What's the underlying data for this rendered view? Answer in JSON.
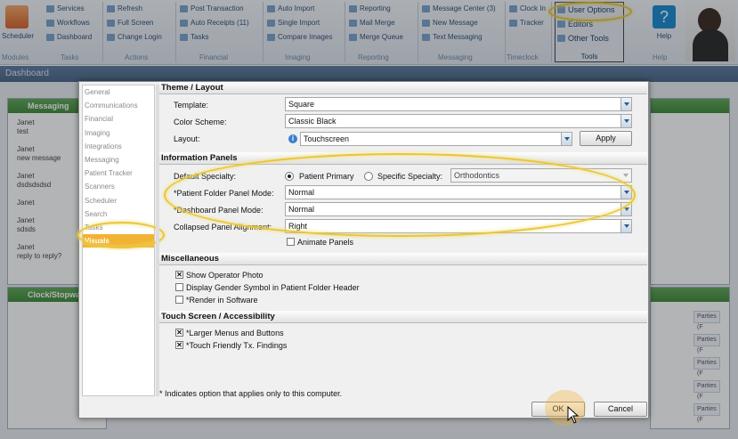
{
  "ribbon": {
    "scheduler": "Scheduler",
    "group1_items": [
      "Services",
      "Workflows",
      "Dashboard"
    ],
    "group2_items": [
      "Refresh",
      "Full Screen",
      "Change Login"
    ],
    "group3_items": [
      "Post Transaction",
      "Auto Receipts (11)",
      "Tasks"
    ],
    "group4_items": [
      "Auto Import",
      "Single Import",
      "Compare Images"
    ],
    "group5_items": [
      "Reporting",
      "Mail Merge",
      "Merge Queue"
    ],
    "group6_items": [
      "Message Center (3)",
      "New Message",
      "Text Messaging"
    ],
    "group7_items": [
      "Clock In",
      "Tracker"
    ],
    "tools_items": [
      "User Options",
      "Editors",
      "Other Tools"
    ],
    "group_labels": [
      "Modules",
      "Tasks",
      "Actions",
      "Financial",
      "Imaging",
      "Reporting",
      "Messaging",
      "Timeclock",
      "Tools",
      "Help"
    ],
    "help_label": "Help"
  },
  "dashboard_bar": {
    "title": "Dashboard"
  },
  "widgets": {
    "messaging_title": "Messaging",
    "messages": [
      {
        "from": "Janet",
        "text": "test"
      },
      {
        "from": "Janet",
        "text": "new message"
      },
      {
        "from": "Janet",
        "text": "dsdsdsdsd"
      },
      {
        "from": "Janet",
        "text": ""
      },
      {
        "from": "Janet",
        "text": "sdsds"
      },
      {
        "from": "Janet",
        "text": "reply to reply?"
      }
    ],
    "clock_title": "Clock/Stopwatch",
    "right_rows": [
      "Parties (F",
      "Re",
      "Parties (F",
      "Re",
      "Parties (F",
      "Re",
      "Parties (F",
      "Re",
      "Parties (F",
      "Re"
    ]
  },
  "dialog": {
    "nav": [
      "General",
      "Communications",
      "Financial",
      "Imaging",
      "Integrations",
      "Messaging",
      "Patient Tracker",
      "Scanners",
      "Scheduler",
      "Search",
      "Tasks",
      "Visuals"
    ],
    "selected_nav": "Visuals",
    "theme": {
      "header": "Theme / Layout",
      "template_label": "Template:",
      "template_value": "Square",
      "color_label": "Color Scheme:",
      "color_value": "Classic Black",
      "layout_label": "Layout:",
      "layout_value": "Touchscreen",
      "apply": "Apply"
    },
    "info": {
      "header": "Information Panels",
      "default_specialty_label": "Default Specialty:",
      "radio_patient_primary": "Patient Primary",
      "radio_specific": "Specific Specialty:",
      "specialty_value": "Orthodontics",
      "folder_mode_label": "*Patient Folder Panel Mode:",
      "folder_mode_value": "Normal",
      "dash_mode_label": "*Dashboard Panel Mode:",
      "dash_mode_value": "Normal",
      "alignment_label": "Collapsed Panel Alignment:",
      "alignment_value": "Right",
      "animate": "Animate Panels"
    },
    "misc": {
      "header": "Miscellaneous",
      "show_photo": "Show Operator Photo",
      "gender_symbol": "Display Gender Symbol in Patient Folder Header",
      "render_software": "*Render in Software"
    },
    "touch": {
      "header": "Touch Screen / Accessibility",
      "larger_menus": "*Larger Menus and Buttons",
      "touch_findings": "*Touch Friendly Tx. Findings"
    },
    "footnote": "* Indicates option that applies only to this computer.",
    "ok": "OK",
    "cancel": "Cancel"
  },
  "colors": {
    "highlight": "#e8c53a",
    "selected_nav": "#f2b233",
    "widget_header": "#3f8a3a"
  }
}
